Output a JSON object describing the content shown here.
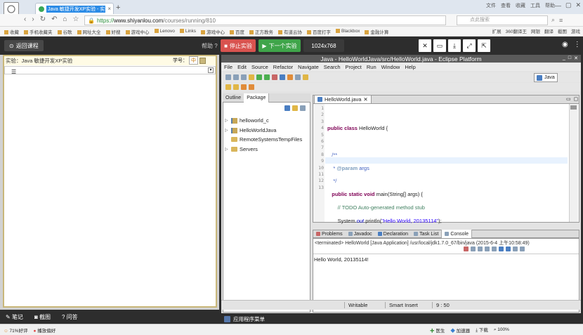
{
  "browser": {
    "tab_title": "Java 敏捷开发XP实验 - 实验楼",
    "tab_close": "×",
    "new_tab": "+",
    "window_menu": [
      "文件",
      "查看",
      "收藏",
      "工具",
      "帮助"
    ],
    "url_https": "https://",
    "url_host": "www.shiyanlou.com",
    "url_path": "/courses/running/810",
    "search_placeholder": "点此搜索",
    "bookmarks": [
      "收藏",
      "手机收藏夹",
      "谷歌",
      "网址大全",
      "好搜",
      "游戏中心",
      "Lenovo",
      "Links",
      "游戏中心",
      "百度",
      "正方教务",
      "有道云协",
      "百度打字",
      "Blackbox",
      "金融计算"
    ],
    "bookmarks_right": [
      "扩展",
      "360翻译王",
      "网银",
      "翻译",
      "截图",
      "游戏"
    ]
  },
  "site": {
    "back_label": "返回课程",
    "help_label": "帮助 ?",
    "stop_label": "停止实验",
    "next_label": "下一个实验",
    "resolution": "1024x768",
    "lab_title": "实验：Java 敏捷开发XP实验",
    "lab_no_label": "学号：",
    "lab_no_value": "中",
    "bottom_tools": [
      "笔记",
      "截图",
      "问答"
    ]
  },
  "eclipse": {
    "title": "Java - HelloWorldJava/src/HelloWorld.java - Eclipse Platform",
    "menu": [
      "File",
      "Edit",
      "Source",
      "Refactor",
      "Navigate",
      "Search",
      "Project",
      "Run",
      "Window",
      "Help"
    ],
    "perspective": "Java",
    "side_tabs": [
      "Outline",
      "Package"
    ],
    "tree": [
      "helloworld_c",
      "HelloWorldJava",
      "RemoteSystemsTempFiles",
      "Servers"
    ],
    "editor_tab": "HelloWorld.java",
    "line_numbers": [
      "1",
      "2",
      "3",
      "4",
      "5",
      "6",
      "7",
      "8",
      "9",
      "10",
      "11",
      "12",
      "13"
    ],
    "code": {
      "l2_kw": "public class",
      "l2_rest": " HelloWorld {",
      "l4": "   /**",
      "l5_a": "    * ",
      "l5_b": "@param",
      "l5_c": " args",
      "l6": "    */",
      "l7_kw": "   public static void",
      "l7_rest": " main(String[] args) {",
      "l8": "       // TODO Auto-generated method stub",
      "l9_a": "       System.",
      "l9_b": "out",
      "l9_c": ".println(",
      "l9_d": "\"Hello World, 20135114\"",
      "l9_e": ");",
      "l10": "   }",
      "l12": "}"
    },
    "console_tabs": [
      "Problems",
      "Javadoc",
      "Declaration",
      "Task List",
      "Console"
    ],
    "terminated": "<terminated> HelloWorld [Java Application] /usr/local/jdk1.7.0_67/bin/java (2015-6-4 上午10:58:49)",
    "output": "Hello World, 20135114!",
    "status": {
      "writable": "Writable",
      "insert": "Smart Insert",
      "position": "9 : 50"
    },
    "app_menu": "应用程序菜单"
  },
  "os": {
    "left": [
      "71%好评",
      "播放偏好"
    ],
    "right": [
      "医生",
      "加速器",
      "下载",
      "100%"
    ]
  }
}
